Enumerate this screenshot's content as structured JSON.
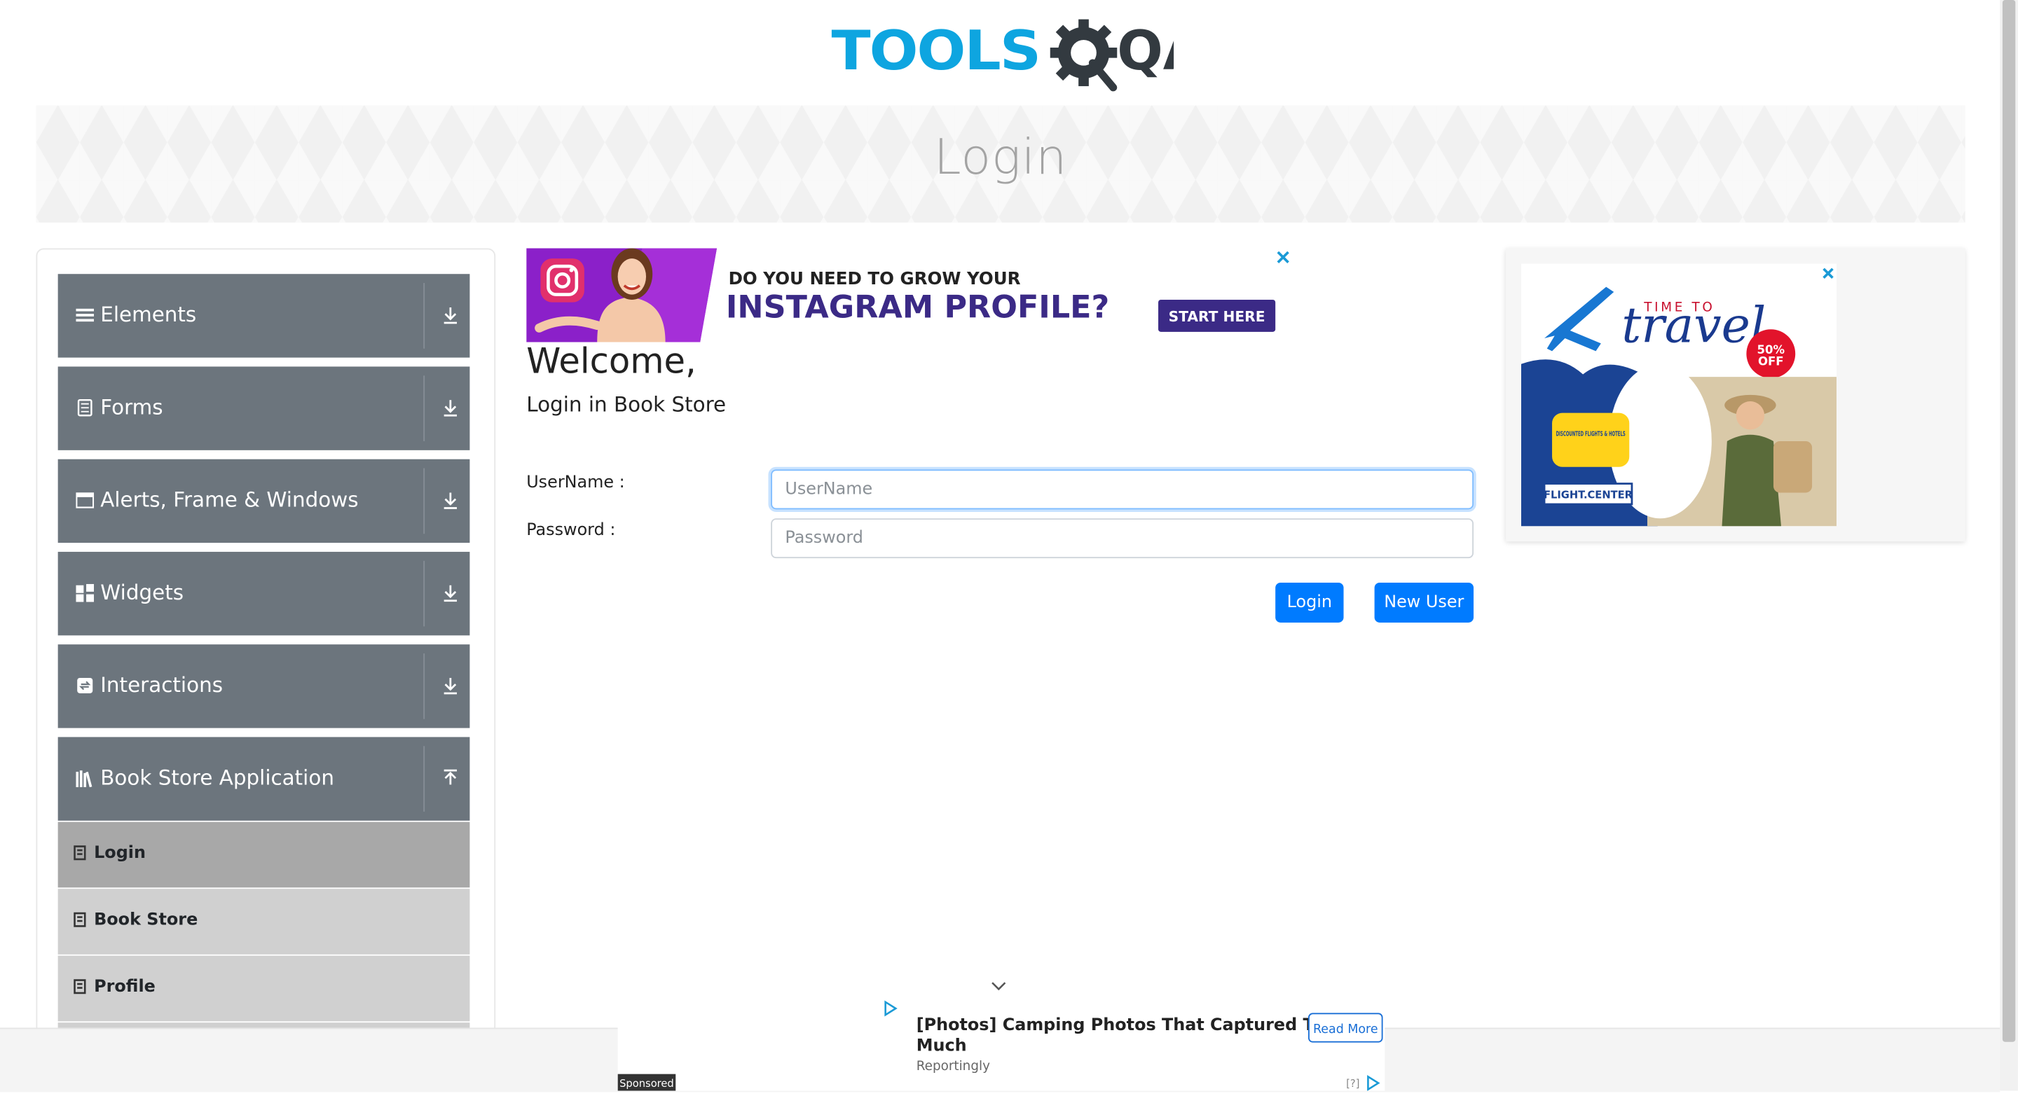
{
  "logo": {
    "text_tools": "TOOLS",
    "text_qa": "QA"
  },
  "banner": {
    "title": "Login"
  },
  "colors": {
    "brand_blue": "#0ea5e0",
    "logo_dark": "#333a40",
    "group_bg": "#6c757d",
    "button_blue": "#007bff",
    "sub_active": "#a8a8a8",
    "sub_bg": "#d0d0d0"
  },
  "sidebar": {
    "groups": [
      {
        "label": "Elements",
        "icon": "hamburger-icon",
        "expanded": false
      },
      {
        "label": "Forms",
        "icon": "document-icon",
        "expanded": false
      },
      {
        "label": "Alerts, Frame & Windows",
        "icon": "window-icon",
        "expanded": false
      },
      {
        "label": "Widgets",
        "icon": "widgets-icon",
        "expanded": false
      },
      {
        "label": "Interactions",
        "icon": "interactions-icon",
        "expanded": false
      },
      {
        "label": "Book Store Application",
        "icon": "books-icon",
        "expanded": true
      }
    ],
    "subitems": [
      {
        "label": "Login",
        "active": true
      },
      {
        "label": "Book Store",
        "active": false
      },
      {
        "label": "Profile",
        "active": false
      }
    ]
  },
  "ad_instagram": {
    "line1": "DO YOU NEED TO GROW YOUR",
    "line2": "INSTAGRAM PROFILE?",
    "cta": "START HERE"
  },
  "ad_travel": {
    "line1": "TIME TO",
    "line2": "travel",
    "discount_top": "50%",
    "discount_bottom": "OFF",
    "badge": "DISCOUNTED FLIGHTS & HOTELS",
    "brand": "FLIGHT.CENTER"
  },
  "main": {
    "welcome": "Welcome,",
    "subtitle": "Login in Book Store",
    "username_label": "UserName :",
    "username_placeholder": "UserName",
    "password_label": "Password :",
    "password_placeholder": "Password",
    "login_button": "Login",
    "new_user_button": "New User"
  },
  "bottom_ad": {
    "headline": "[Photos] Camping Photos That Captured Too Much",
    "source": "Reportingly",
    "cta": "Read More",
    "sponsored": "Sponsored",
    "info": "[?]"
  }
}
